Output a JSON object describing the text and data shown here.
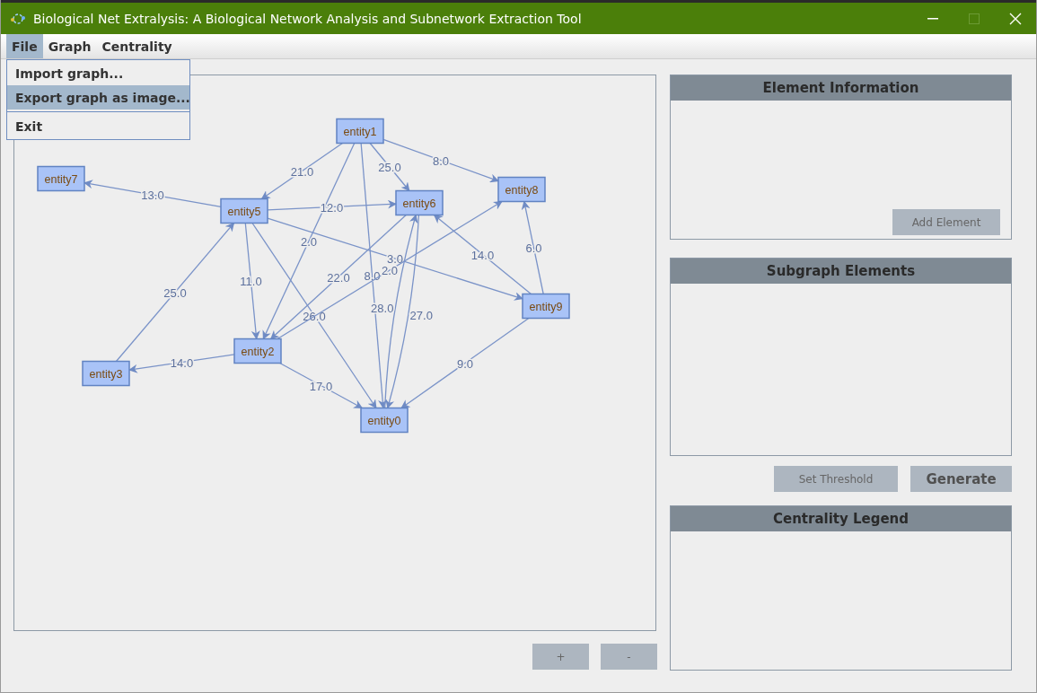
{
  "window": {
    "title": "Biological Net Extralysis: A Biological Network Analysis and Subnetwork Extraction Tool"
  },
  "menu_bar": [
    {
      "label": "File",
      "selected": true
    },
    {
      "label": "Graph",
      "selected": false
    },
    {
      "label": "Centrality",
      "selected": false
    }
  ],
  "file_menu": [
    {
      "label": "Import graph...",
      "selected": false,
      "kind": "item"
    },
    {
      "label": "Export graph as image...",
      "selected": true,
      "kind": "item"
    },
    {
      "kind": "separator"
    },
    {
      "label": "Exit",
      "selected": false,
      "kind": "item"
    }
  ],
  "graph": {
    "nodes": [
      "entity1",
      "entity7",
      "entity5",
      "entity6",
      "entity8",
      "entity9",
      "entity2",
      "entity3",
      "entity0"
    ],
    "edge_weights": [
      "21.0",
      "2.0",
      "8.0",
      "25.0",
      "8.0",
      "13.0",
      "12.0",
      "11.0",
      "26.0",
      "3.0",
      "25.0",
      "14.0",
      "17.0",
      "22.0",
      "2.0",
      "28.0",
      "27.0",
      "14.0",
      "6.0",
      "9.0"
    ],
    "zoom_buttons": [
      "+",
      "-"
    ]
  },
  "element_information": {
    "title": "Element Information",
    "button": "Add Element"
  },
  "subgraph_elements": {
    "title": "Subgraph Elements"
  },
  "subgraph_buttons": [
    {
      "label": "Set Threshold",
      "kind": "plain"
    },
    {
      "label": "Generate",
      "kind": "primary"
    }
  ],
  "centrality_legend": {
    "title": "Centrality Legend"
  }
}
